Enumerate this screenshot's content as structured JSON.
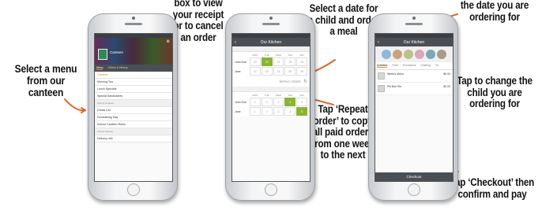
{
  "captions": {
    "select_menu": "Select a menu from our canteen",
    "box_receipt": "box to view your receipt or to cancel an order",
    "select_date": "Select a date for a child and order a meal",
    "repeat_order": "Tap ‘Repeat order’ to copy all paid orders from one week to the next",
    "date_ordering": "the date you are ordering for",
    "change_child": "Tap to change the child you are ordering for",
    "checkout": "Tap ‘Checkout’ then confirm and pay"
  },
  "phone1": {
    "title": "Canteen",
    "tab1": "Menu",
    "tab2": "Orders & History",
    "rows": [
      "Canteen",
      "Morning Tea",
      "Lunch Specials",
      "Special Sandwiches",
      "School Canteen",
      "Drinks List",
      "Fundraising Day",
      "School Canteen Rules",
      "School Notices",
      "Delivery info"
    ]
  },
  "phone2": {
    "title": "Our Kitchen",
    "repeat_label": "REPEAT ORDER",
    "days": [
      "MON",
      "TUE",
      "WED",
      "THU",
      "FRI"
    ],
    "kids": [
      "John Doe",
      "Jane"
    ],
    "dates_w1": [
      "22",
      "23",
      "24",
      "25",
      "26"
    ],
    "dates_w2": [
      "1",
      "2",
      "3",
      "4",
      "5"
    ]
  },
  "phone3": {
    "title": "Our Kitchen",
    "tabs": [
      "Activities",
      "Fees",
      "Excursions",
      "Clothing",
      "Ye"
    ],
    "items": [
      {
        "name": "Week's Menu",
        "price": "$0.00"
      },
      {
        "name": "Pie Box Pie",
        "price": "$0.00"
      }
    ],
    "checkout": "Checkout"
  },
  "colors": {
    "arrow": "#e2662c",
    "accent": "#8ab432"
  }
}
